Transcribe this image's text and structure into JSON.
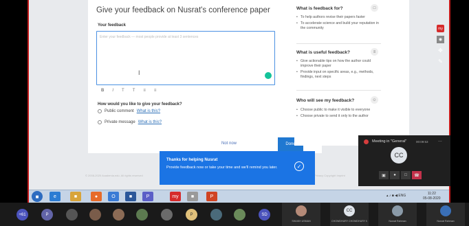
{
  "feedback_card": {
    "title": "Give your feedback on Nusrat's conference paper",
    "feedback_label": "Your feedback",
    "placeholder": "Enter your feedback — most people provide at least 3 sentences",
    "cursor_glyph": "I",
    "toolbar": [
      "B",
      "I",
      "T",
      "T",
      "≡",
      "≡"
    ],
    "question": "How would you like to give your feedback?",
    "options": [
      {
        "label": "Public comment",
        "link": "What is this?"
      },
      {
        "label": "Private message",
        "link": "What is this?"
      }
    ],
    "not_now": "Not now",
    "done": "Done"
  },
  "sidebar": {
    "sections": [
      {
        "heading": "What is feedback for?",
        "icon": "chat-icon",
        "bullets": [
          "To help authors revise their papers faster",
          "To accelerate science and build your reputation in the community"
        ]
      },
      {
        "heading": "What is useful feedback?",
        "icon": "list-icon",
        "bullets": [
          "Give actionable tips on how the author could improve their paper",
          "Provide input on specific areas, e.g., methods, findings, next steps"
        ]
      },
      {
        "heading": "Who will see my feedback?",
        "icon": "person-icon",
        "bullets": [
          "Choose public to make it visible to everyone",
          "Choose private to send it only to the author"
        ]
      }
    ]
  },
  "footer": {
    "left": "© 2008-2020 Academia.edu. All rights reserved",
    "right": "Privacy   Copyright   Imprint"
  },
  "toast": {
    "title": "Thanks for helping Nusrat",
    "body": "Provide feedback now or take your time and we'll remind you later.",
    "check": "✓"
  },
  "meeting": {
    "title": "Meeting in \"General\"",
    "time": "00:09:53",
    "avatar": "CC",
    "more": "..."
  },
  "taskbar": {
    "apps": [
      "e",
      "■",
      "●",
      "O",
      "■",
      "P",
      "my",
      "■",
      "P"
    ],
    "tray": "▴ ♪ ■ ◀ ENG",
    "clock_time": "11:22",
    "clock_date": "05-08-2020"
  },
  "participants": {
    "count_badge": "+61",
    "initial_p1": "P",
    "initial_p2": "P",
    "initial_sd": "SD",
    "named": [
      {
        "avatar": "",
        "name": "SHAIKH USMAN"
      },
      {
        "avatar": "CC",
        "name": "CHOWDHURY CHOWDHURY NUSRAT"
      },
      {
        "avatar": "",
        "name": "Nusrat Rahman"
      },
      {
        "avatar": "",
        "name": "Nusrat Rahman"
      }
    ]
  },
  "tools": {
    "my": "my"
  }
}
